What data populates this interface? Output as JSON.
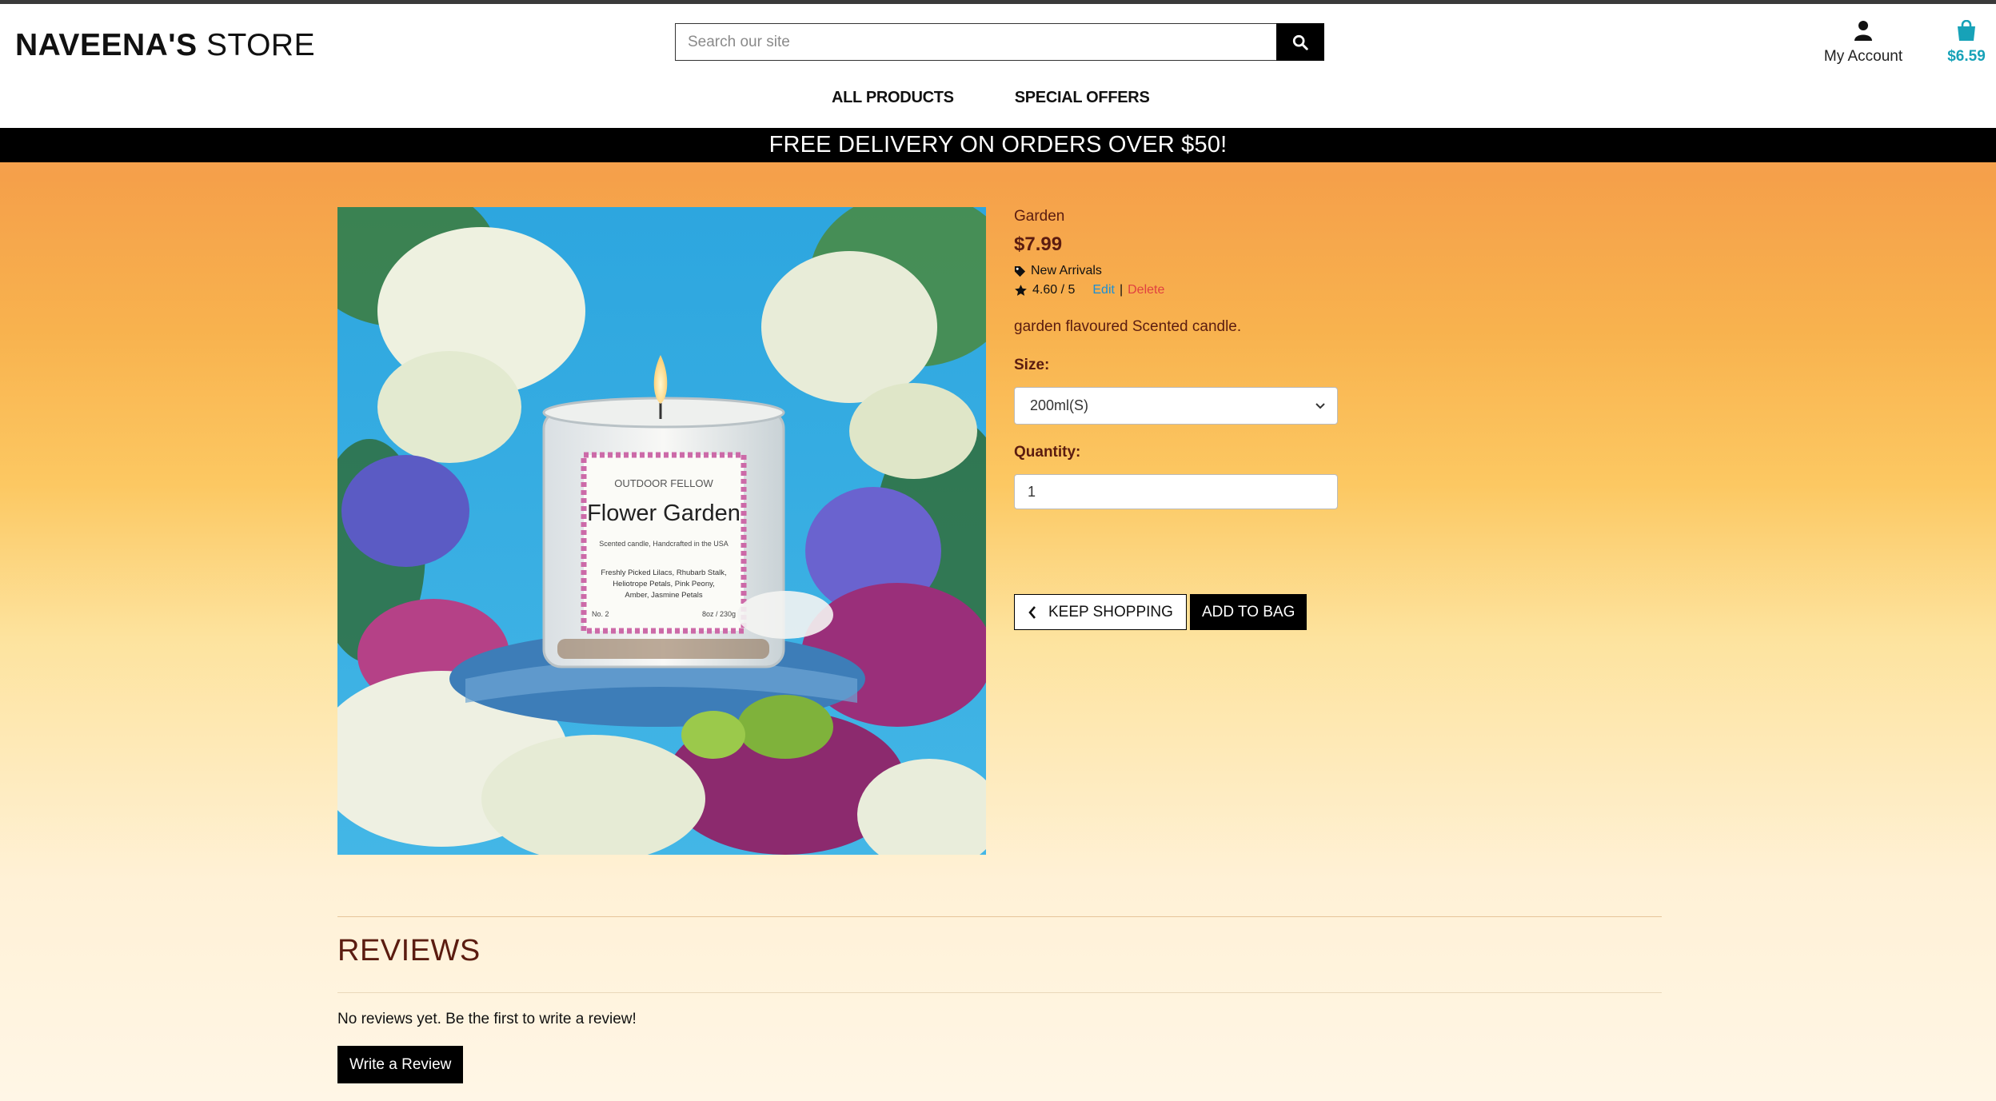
{
  "header": {
    "logo_bold": "NAVEENA'S",
    "logo_rest": "STORE",
    "search_placeholder": "Search our site",
    "account_label": "My Account",
    "bag_total": "$6.59"
  },
  "nav": {
    "items": [
      {
        "label": "ALL PRODUCTS"
      },
      {
        "label": "SPECIAL OFFERS"
      }
    ]
  },
  "banner": {
    "text": "FREE DELIVERY ON ORDERS OVER $50!"
  },
  "product": {
    "name": "Garden",
    "price": "$7.99",
    "category": "New Arrivals",
    "rating": "4.60 / 5",
    "edit_label": "Edit",
    "separator": "|",
    "delete_label": "Delete",
    "description": "garden flavoured Scented candle.",
    "size_label": "Size:",
    "size_selected": "200ml(S)",
    "quantity_label": "Quantity:",
    "quantity_value": "1",
    "image_label": {
      "brand": "OUTDOOR FELLOW",
      "title": "Flower Garden",
      "subtitle": "Scented candle, Handcrafted in the USA",
      "notes": [
        "Freshly Picked Lilacs, Rhubarb Stalk,",
        "Heliotrope Petals, Pink Peony,",
        "Amber, Jasmine Petals"
      ],
      "number": "No. 2",
      "weight": "8oz / 230g"
    }
  },
  "actions": {
    "keep_shopping": "KEEP SHOPPING",
    "add_to_bag": "ADD TO BAG"
  },
  "reviews": {
    "title": "REVIEWS",
    "empty_text": "No reviews yet. Be the first to write a review!",
    "write_button": "Write a Review"
  },
  "colors": {
    "accent_bag": "#17a2b8",
    "text_maroon": "#5b1c10",
    "edit_link": "#1a8fd6",
    "delete_link": "#e04040"
  }
}
